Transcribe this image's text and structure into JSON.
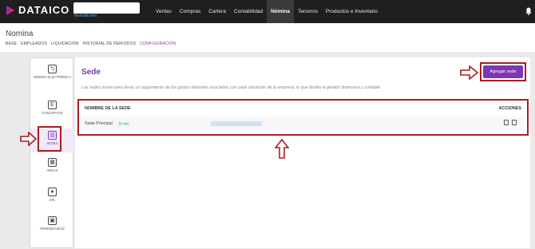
{
  "app": {
    "logo_text": "DATAICO",
    "search_sub": "Tesmails test"
  },
  "nav": [
    {
      "label": "Ventas",
      "active": false
    },
    {
      "label": "Compras",
      "active": false
    },
    {
      "label": "Cartera",
      "active": false
    },
    {
      "label": "Contabilidad",
      "active": false
    },
    {
      "label": "Nómina",
      "active": true
    },
    {
      "label": "Terceros",
      "active": false
    },
    {
      "label": "Productos e Inventario",
      "active": false
    }
  ],
  "page": {
    "title": "Nomina",
    "tabs": [
      {
        "label": "BASE",
        "active": false
      },
      {
        "label": "EMPLEADOS",
        "active": false
      },
      {
        "label": "LIQUIDACIÓN",
        "active": false
      },
      {
        "label": "HISTORIAL DE PERIODOS",
        "active": false
      },
      {
        "label": "CONFIGURACIÓN",
        "active": true
      }
    ]
  },
  "sidebar": {
    "items": [
      {
        "label": "NÓMINA ELECTRÓNICA",
        "icon": "exit-icon",
        "glyph": "⮌",
        "active": false
      },
      {
        "label": "CONCEPTOS",
        "icon": "document-icon",
        "glyph": "E",
        "active": false
      },
      {
        "label": "SEDES",
        "icon": "building-icon",
        "glyph": "▥",
        "active": true
      },
      {
        "label": "ÁREAS",
        "icon": "grid-icon",
        "glyph": "▦",
        "active": false
      },
      {
        "label": "ARL",
        "icon": "helmet-icon",
        "glyph": "●",
        "active": false
      },
      {
        "label": "PERIODICIDAD",
        "icon": "calendar-icon",
        "glyph": "▣",
        "active": false
      }
    ]
  },
  "sede": {
    "title": "Sede",
    "description": "Las sedes sirven para llevar un seguimiento de los gastos laborales asociados con cada ubicación de la empresa, lo que facilita la gestión financiera y contable.",
    "add_button": "Agregar sede",
    "columns": {
      "name": "NOMBRE DE LA SEDE",
      "actions": "ACCIONES"
    },
    "rows": [
      {
        "name": "Sede Principal",
        "badge": "En uso"
      }
    ]
  },
  "colors": {
    "accent": "#7e37b0",
    "highlight": "#a61e22",
    "topbar": "#1f1f1f"
  }
}
